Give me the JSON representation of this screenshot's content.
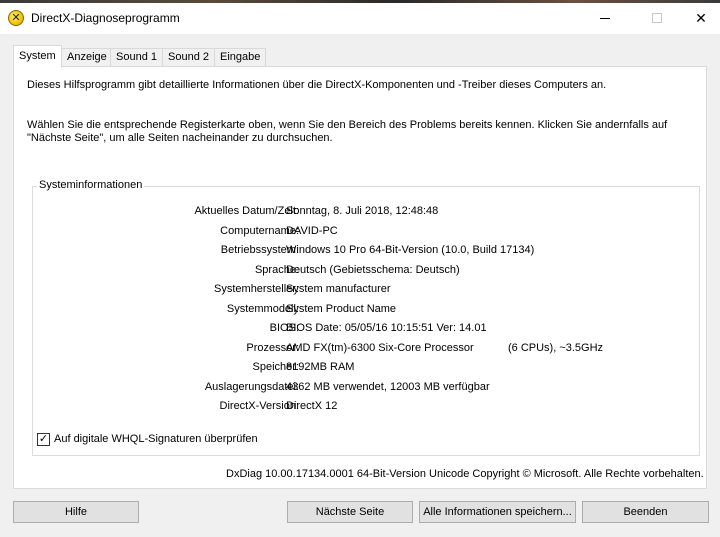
{
  "window": {
    "title": "DirectX-Diagnoseprogramm",
    "controls": {
      "minimize": "",
      "maximize": "",
      "close": "✕"
    }
  },
  "tabs": [
    {
      "label": "System",
      "active": true
    },
    {
      "label": "Anzeige",
      "active": false
    },
    {
      "label": "Sound 1",
      "active": false
    },
    {
      "label": "Sound 2",
      "active": false
    },
    {
      "label": "Eingabe",
      "active": false
    }
  ],
  "intro": {
    "line1": "Dieses Hilfsprogramm gibt detaillierte Informationen über die DirectX-Komponenten und -Treiber dieses Computers an.",
    "line2": "Wählen Sie die entsprechende Registerkarte oben, wenn Sie den Bereich des Problems bereits kennen. Klicken Sie andernfalls auf \"Nächste Seite\", um alle Seiten nacheinander zu durchsuchen."
  },
  "sysinfo": {
    "legend": "Systeminformationen",
    "rows": [
      {
        "label": "Aktuelles Datum/Zeit:",
        "value": "Sonntag, 8. Juli 2018, 12:48:48"
      },
      {
        "label": "Computername:",
        "value": "DAVID-PC"
      },
      {
        "label": "Betriebssystem:",
        "value": "Windows 10 Pro 64-Bit-Version (10.0, Build 17134)"
      },
      {
        "label": "Sprache:",
        "value": "Deutsch (Gebietsschema: Deutsch)"
      },
      {
        "label": "Systemhersteller:",
        "value": "System manufacturer"
      },
      {
        "label": "Systemmodell:",
        "value": "System Product Name"
      },
      {
        "label": "BIOS:",
        "value": "BIOS Date: 05/05/16 10:15:51 Ver: 14.01"
      },
      {
        "label": "Prozessor:",
        "value": "AMD FX(tm)-6300 Six-Core Processor",
        "extra": "(6 CPUs), ~3.5GHz"
      },
      {
        "label": "Speicher:",
        "value": "8192MB RAM"
      },
      {
        "label": "Auslagerungsdatei:",
        "value": "4362 MB verwendet, 12003 MB verfügbar"
      },
      {
        "label": "DirectX-Version:",
        "value": "DirectX 12"
      }
    ]
  },
  "whql": {
    "label": "Auf digitale WHQL-Signaturen überprüfen",
    "checked": true,
    "mark": "✓"
  },
  "footer": "DxDiag 10.00.17134.0001 64-Bit-Version Unicode Copyright © Microsoft. Alle Rechte vorbehalten.",
  "buttons": {
    "help": "Hilfe",
    "next": "Nächste Seite",
    "save": "Alle Informationen speichern...",
    "exit": "Beenden"
  }
}
